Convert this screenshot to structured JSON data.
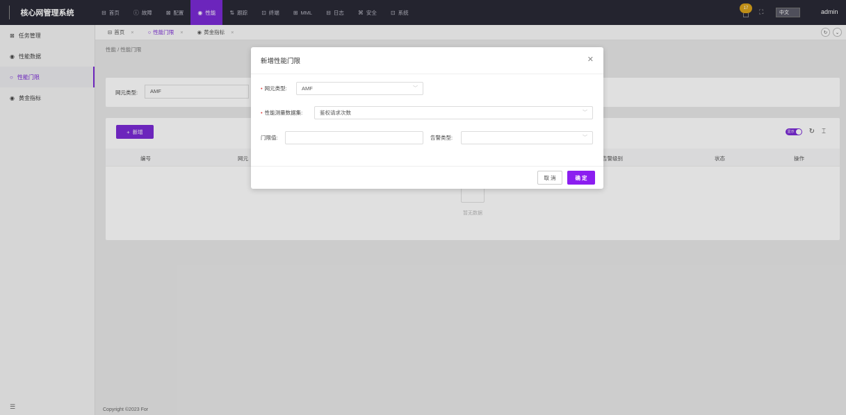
{
  "app": {
    "title": "核心网管理系统"
  },
  "topnav": [
    {
      "icon": "home-icon",
      "glyph": "⊟",
      "label": "首页"
    },
    {
      "icon": "fault-icon",
      "glyph": "ⓘ",
      "label": "故障"
    },
    {
      "icon": "config-icon",
      "glyph": "⊠",
      "label": "配置"
    },
    {
      "icon": "performance-icon",
      "glyph": "◉",
      "label": "性能",
      "active": true
    },
    {
      "icon": "trace-icon",
      "glyph": "⇅",
      "label": "跟踪"
    },
    {
      "icon": "terminal-icon",
      "glyph": "⊡",
      "label": "终端"
    },
    {
      "icon": "mml-icon",
      "glyph": "⊞",
      "label": "MML"
    },
    {
      "icon": "log-icon",
      "glyph": "⊟",
      "label": "日志"
    },
    {
      "icon": "security-icon",
      "glyph": "⌘",
      "label": "安全"
    },
    {
      "icon": "system-icon",
      "glyph": "⊡",
      "label": "系统"
    }
  ],
  "header": {
    "notification_count": "17",
    "language": "中文",
    "user": "admin"
  },
  "sidebar": {
    "items": [
      {
        "icon": "task-icon",
        "glyph": "⊠",
        "label": "任务管理"
      },
      {
        "icon": "perf-data-icon",
        "glyph": "◉",
        "label": "性能数据"
      },
      {
        "icon": "threshold-icon",
        "glyph": "○",
        "label": "性能门限",
        "active": true
      },
      {
        "icon": "gold-kpi-icon",
        "glyph": "◉",
        "label": "黄金指标"
      }
    ]
  },
  "tabs": [
    {
      "icon": "home-icon",
      "glyph": "⊟",
      "label": "首页"
    },
    {
      "icon": "threshold-icon",
      "glyph": "○",
      "label": "性能门限",
      "active": true
    },
    {
      "icon": "gold-kpi-icon",
      "glyph": "◉",
      "label": "黄金指标"
    }
  ],
  "breadcrumb": "性能 / 性能门限",
  "filter": {
    "label": "网元类型:",
    "value": "AMF"
  },
  "table": {
    "add_label": "新增",
    "toggle_label": "显示",
    "columns": [
      "编号",
      "网元",
      "告警级别",
      "状态",
      "操作"
    ],
    "empty_text": "暂无数据"
  },
  "footer": "Copyright ©2023 For",
  "modal": {
    "title": "新增性能门限",
    "ne_type_label": "网元类型:",
    "ne_type_value": "AMF",
    "measure_label": "性能测量数据集:",
    "measure_value": "鉴权请求次数",
    "threshold_label": "门限值:",
    "threshold_value": "",
    "alarm_type_label": "告警类型:",
    "alarm_type_value": "",
    "cancel_label": "取 消",
    "ok_label": "确 定"
  },
  "colors": {
    "accent": "#7b2bd6",
    "topbar": "#2a2a36",
    "badge": "#d9a21b"
  }
}
